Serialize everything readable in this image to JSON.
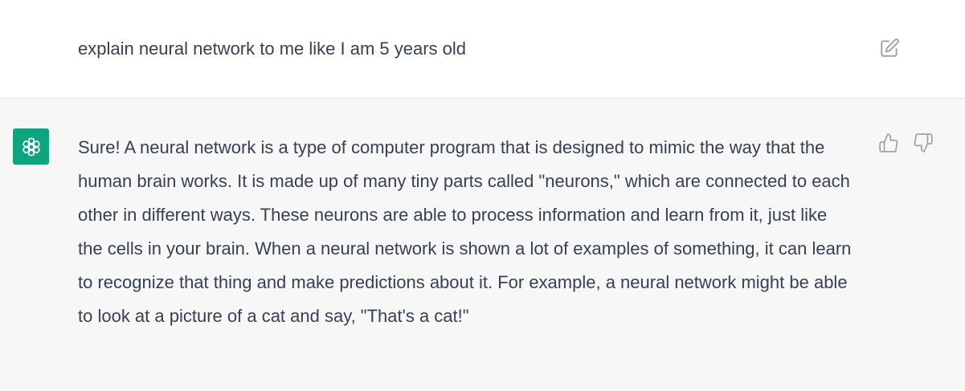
{
  "user_message": {
    "text": "explain neural network to me like I am 5 years old",
    "edit_icon": "edit-icon"
  },
  "assistant_message": {
    "avatar_icon": "openai-logo-icon",
    "text": "Sure! A neural network is a type of computer program that is designed to mimic the way that the human brain works. It is made up of many tiny parts called \"neurons,\" which are connected to each other in different ways. These neurons are able to process information and learn from it, just like the cells in your brain. When a neural network is shown a lot of examples of something, it can learn to recognize that thing and make predictions about it. For example, a neural network might be able to look at a picture of a cat and say, \"That's a cat!\"",
    "feedback": {
      "thumbs_up_icon": "thumbs-up-icon",
      "thumbs_down_icon": "thumbs-down-icon"
    }
  },
  "colors": {
    "text": "#374151",
    "assistant_bg": "#f7f7f8",
    "avatar_bg": "#10a37f",
    "icon": "#9ca3af"
  }
}
